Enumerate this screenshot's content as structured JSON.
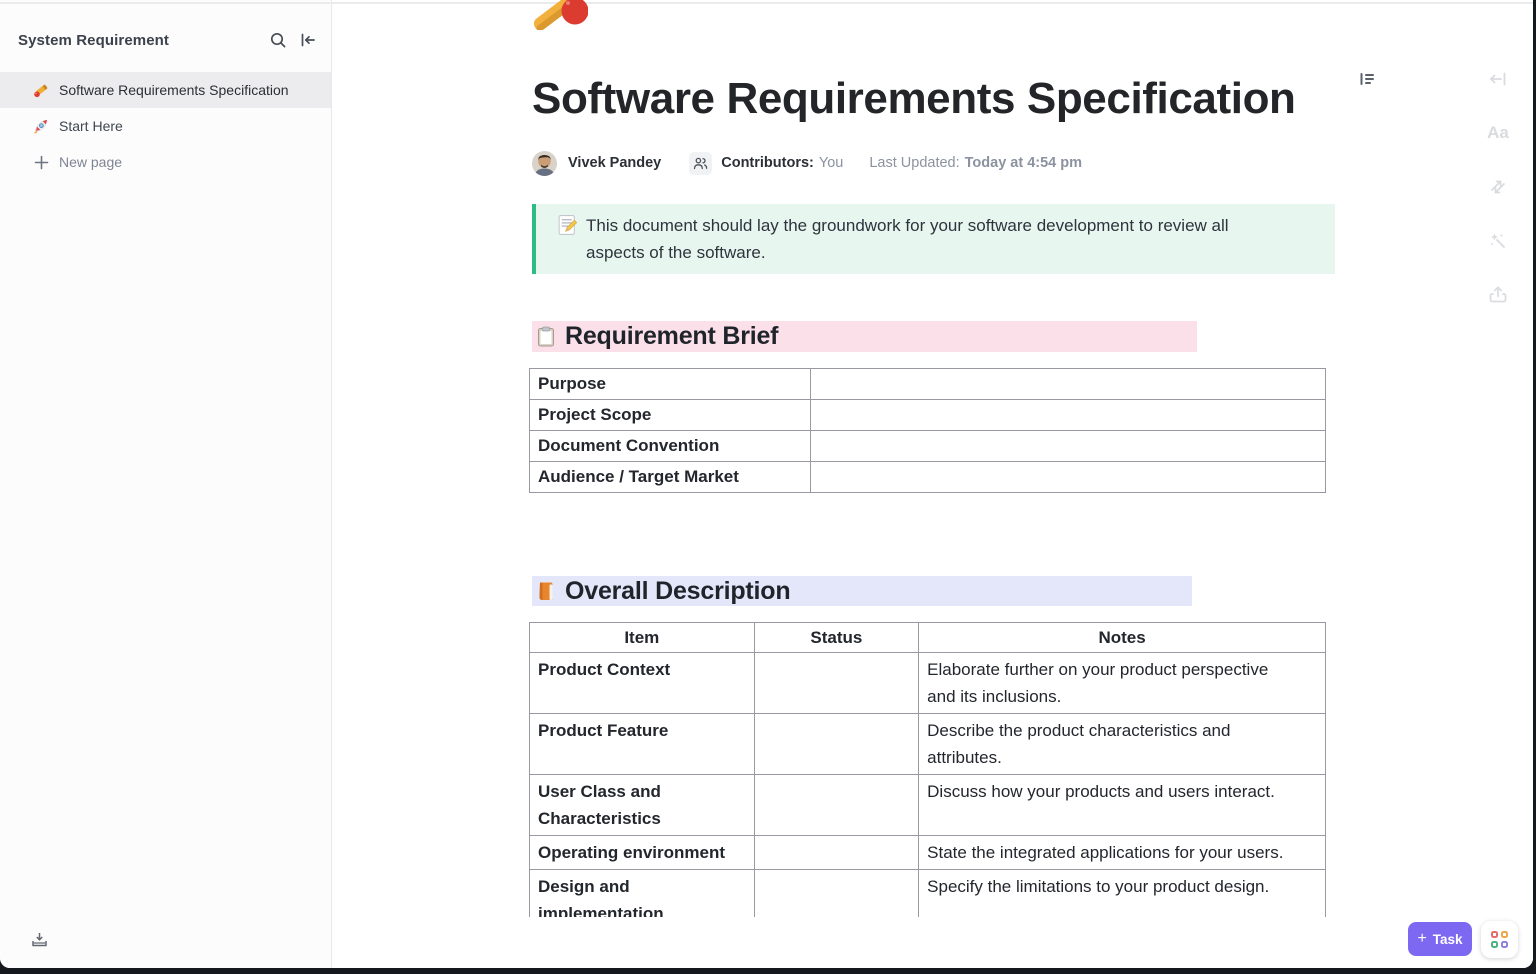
{
  "sidebar": {
    "title": "System Requirement",
    "items": [
      {
        "label": "Software Requirements Specification",
        "icon": "cricket-bat-emoji",
        "selected": true
      },
      {
        "label": "Start Here",
        "icon": "rocket-emoji",
        "selected": false
      }
    ],
    "new_page_label": "New page"
  },
  "doc": {
    "icon": "cricket-bat-and-ball-emoji",
    "title": "Software Requirements Specification",
    "author": "Vivek Pandey",
    "contributors_label": "Contributors:",
    "contributors_value": "You",
    "last_updated_label": "Last Updated:",
    "last_updated_value": "Today at 4:54 pm",
    "callout": {
      "icon": "memo-emoji",
      "text": "This document should lay the groundwork for your software development to review all aspects of the software."
    }
  },
  "requirement_brief": {
    "icon": "clipboard-emoji",
    "heading": "Requirement Brief",
    "highlight_color": "#fbdfe9",
    "rows": [
      "Purpose",
      "Project Scope",
      "Document Convention",
      "Audience / Target Market"
    ]
  },
  "overall_description": {
    "icon": "orange-book-emoji",
    "heading": "Overall Description",
    "highlight_color": "#e3e7f9",
    "columns": [
      "Item",
      "Status",
      "Notes"
    ],
    "rows": [
      {
        "item": "Product Context",
        "status": "",
        "notes": "Elaborate further on your product perspective and its inclusions."
      },
      {
        "item": "Product Feature",
        "status": "",
        "notes": "Describe the product characteristics and attributes."
      },
      {
        "item": "User Class and Characteristics",
        "status": "",
        "notes": "Discuss how your products and users interact."
      },
      {
        "item": "Operating environment",
        "status": "",
        "notes": "State the integrated applications for your users."
      },
      {
        "item": "Design and implementation",
        "status": "",
        "notes": "Specify the limitations to your product design."
      }
    ]
  },
  "actions": {
    "task_label": "Task",
    "task_plus": "+"
  },
  "colors": {
    "accent_purple": "#7d68f1",
    "callout_green": "#2bbd85",
    "callout_bg": "#e7f7f0",
    "pink_highlight": "#fbdfe9",
    "lavender_highlight": "#e3e7f9",
    "selected_item_bg": "#ececee"
  }
}
